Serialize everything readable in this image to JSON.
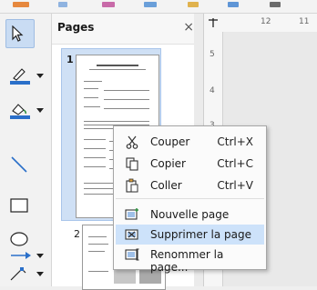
{
  "panel": {
    "title": "Pages",
    "close_glyph": "×",
    "pages": [
      {
        "number": "1"
      },
      {
        "number": "2"
      }
    ]
  },
  "ruler": {
    "top_labels": [
      "12",
      "11"
    ],
    "left_labels": [
      "5",
      "4",
      "3"
    ]
  },
  "context_menu": {
    "items": [
      {
        "label": "Couper",
        "shortcut": "Ctrl+X",
        "icon": "scissors-icon"
      },
      {
        "label": "Copier",
        "shortcut": "Ctrl+C",
        "icon": "copy-icon"
      },
      {
        "label": "Coller",
        "shortcut": "Ctrl+V",
        "icon": "paste-icon"
      },
      {
        "label": "Nouvelle page",
        "icon": "new-page-icon"
      },
      {
        "label": "Supprimer la page",
        "icon": "delete-page-icon",
        "highlighted": true
      },
      {
        "label": "Renommer la page...",
        "icon": "rename-page-icon"
      }
    ]
  },
  "colors": {
    "accent": "#2a6fc9",
    "highlight": "#cde2fa",
    "selected_thumb": "#cfe0f5"
  }
}
